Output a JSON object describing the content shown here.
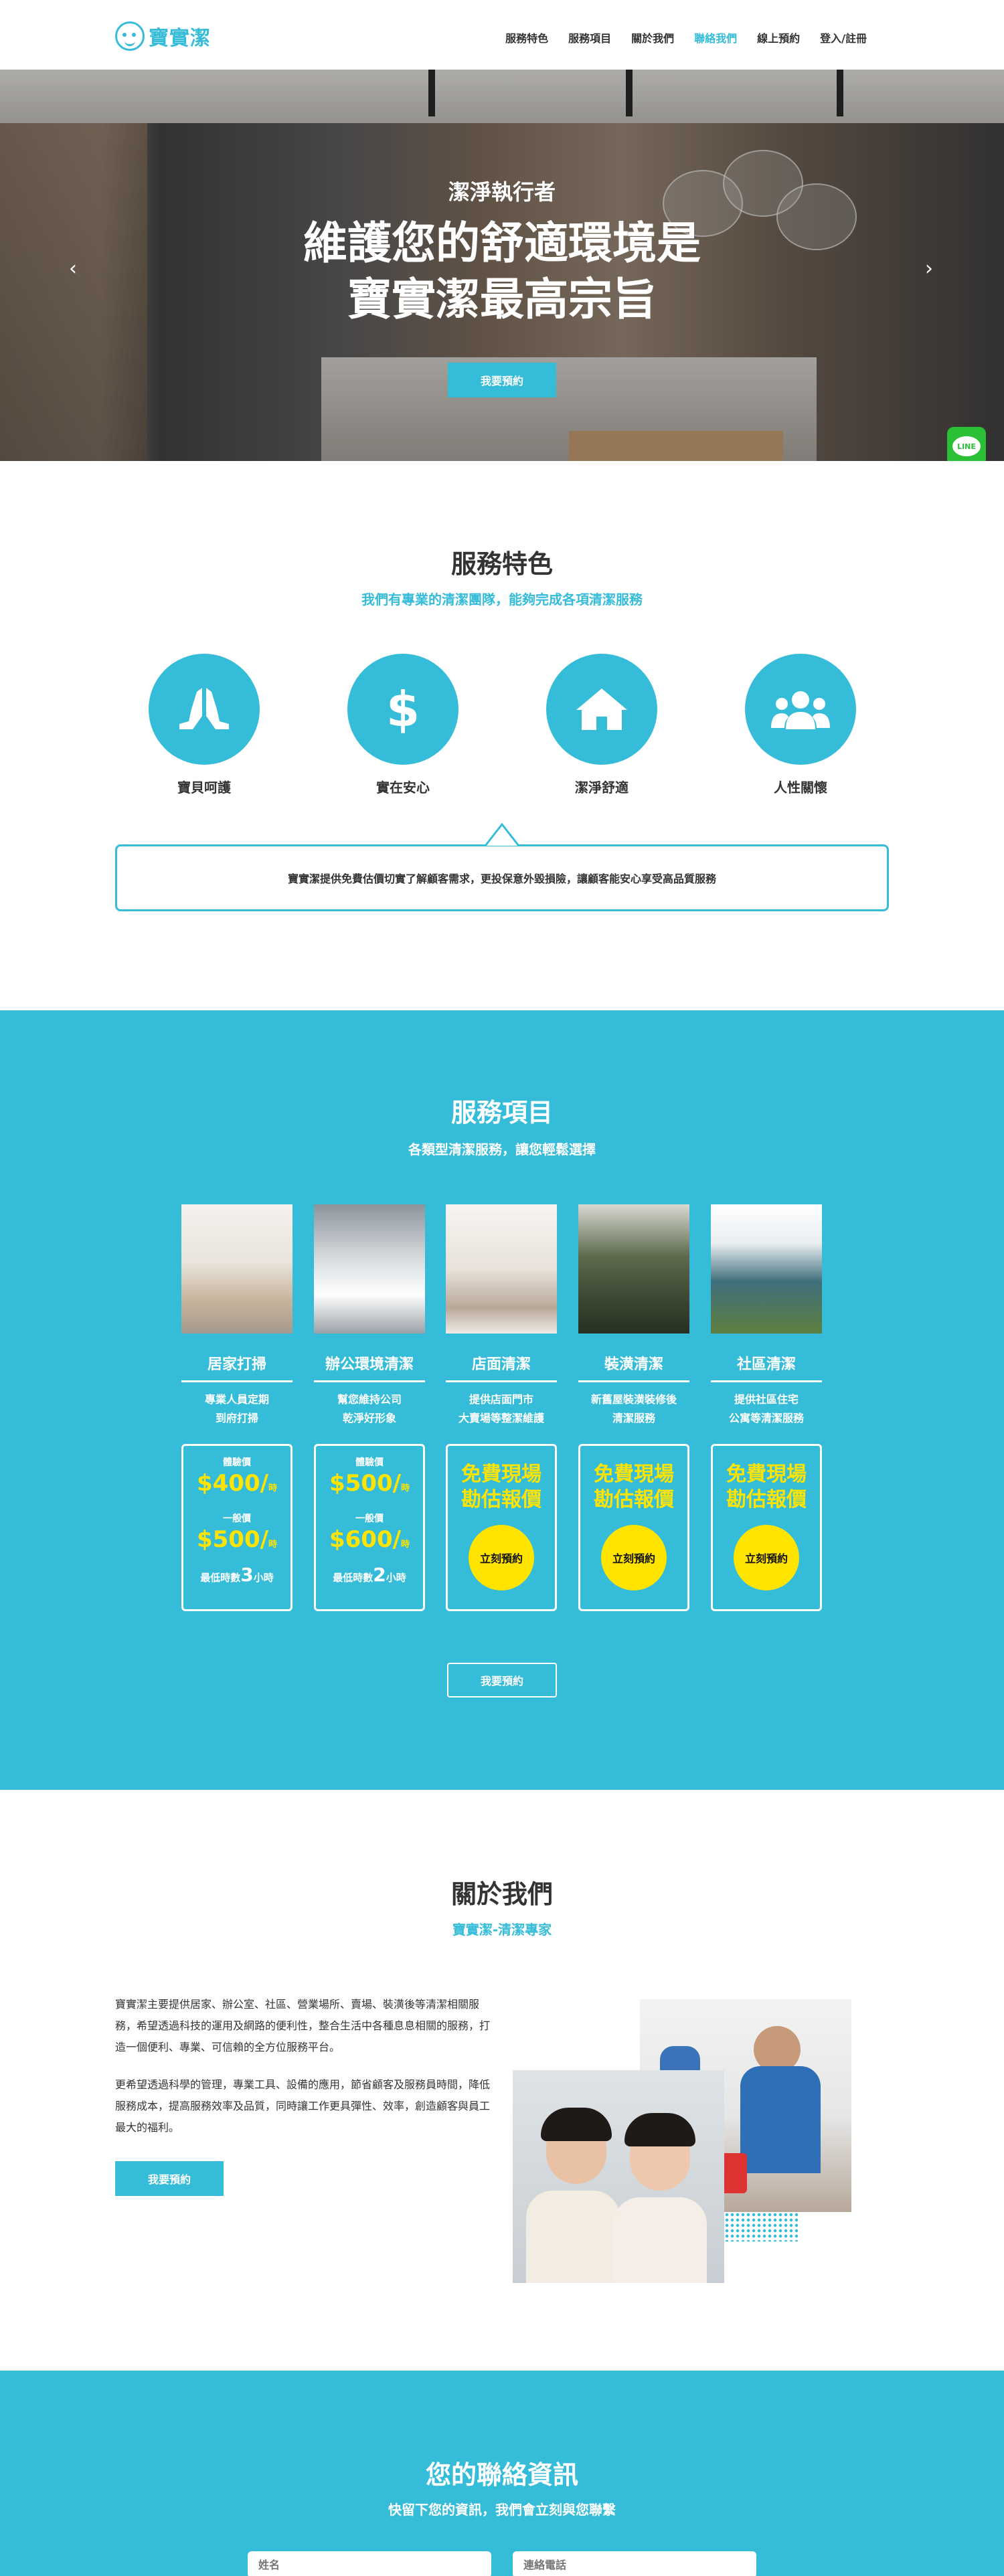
{
  "header": {
    "logo_text": "寶實潔",
    "nav": [
      "服務特色",
      "服務項目",
      "關於我們",
      "聯絡我們",
      "線上預約",
      "登入/註冊"
    ],
    "active_nav": "聯絡我們"
  },
  "hero": {
    "subtitle": "潔淨執行者",
    "title_line1": "維護您的舒適環境是",
    "title_line2": "寶實潔最高宗旨",
    "button": "我要預約",
    "prev_icon": "chevron-left-icon",
    "next_icon": "chevron-right-icon",
    "line_label": "LINE"
  },
  "features": {
    "title": "服務特色",
    "subtitle": "我們有專業的清潔團隊，能夠完成各項清潔服務",
    "items": [
      {
        "label": "寶貝呵護",
        "icon": "praying-hands-icon"
      },
      {
        "label": "實在安心",
        "icon": "dollar-icon"
      },
      {
        "label": "潔淨舒適",
        "icon": "home-icon"
      },
      {
        "label": "人性關懷",
        "icon": "users-icon"
      }
    ],
    "description": "寶實潔提供免費估價切實了解顧客需求，更投保意外毀損險，讓顧客能安心享受高品質服務"
  },
  "services": {
    "title": "服務項目",
    "subtitle": "各類型清潔服務，讓您輕鬆選擇",
    "items": [
      {
        "name": "居家打掃",
        "desc": "專業人員定期\n到府打掃"
      },
      {
        "name": "辦公環境清潔",
        "desc": "幫您維持公司\n乾淨好形象"
      },
      {
        "name": "店面清潔",
        "desc": "提供店面門市\n大賣場等整潔維護"
      },
      {
        "name": "裝潢清潔",
        "desc": "新舊屋裝潢裝修後\n清潔服務"
      },
      {
        "name": "社區清潔",
        "desc": "提供社區住宅\n公寓等清潔服務"
      }
    ],
    "price_boxes": [
      {
        "trial_label": "體驗價",
        "trial_price": "$400/",
        "unit": "時",
        "normal_label": "一般價",
        "normal_price": "$500/",
        "min_prefix": "最低時數",
        "min_hours": "3",
        "min_suffix": "小時"
      },
      {
        "trial_label": "體驗價",
        "trial_price": "$500/",
        "unit": "時",
        "normal_label": "一般價",
        "normal_price": "$600/",
        "min_prefix": "最低時數",
        "min_hours": "2",
        "min_suffix": "小時"
      }
    ],
    "free_quote_line1": "免費現場",
    "free_quote_line2": "勘估報價",
    "book_now": "立刻預約",
    "button": "我要預約"
  },
  "about": {
    "title": "關於我們",
    "subtitle": "寶實潔-清潔專家",
    "para1": "寶實潔主要提供居家、辦公室、社區、營業場所、賣場、裝潢後等清潔相關服務，希望透過科技的運用及網路的便利性，整合生活中各種息息相關的服務，打造一個便利、專業、可信賴的全方位服務平台。",
    "para2": "更希望透過科學的管理，專業工具、設備的應用，節省顧客及服務員時間，降低服務成本，提高服務效率及品質，同時讓工作更具彈性、效率，創造顧客與員工最大的福利。",
    "button": "我要預約"
  },
  "contact": {
    "title": "您的聯絡資訊",
    "subtitle": "快留下您的資訊，我們會立刻與您聯繫",
    "name_placeholder": "姓名",
    "phone_placeholder": "連絡電話"
  },
  "colors": {
    "accent": "#35bcd9",
    "highlight": "#ffe400",
    "line_green": "#2bbf36"
  }
}
